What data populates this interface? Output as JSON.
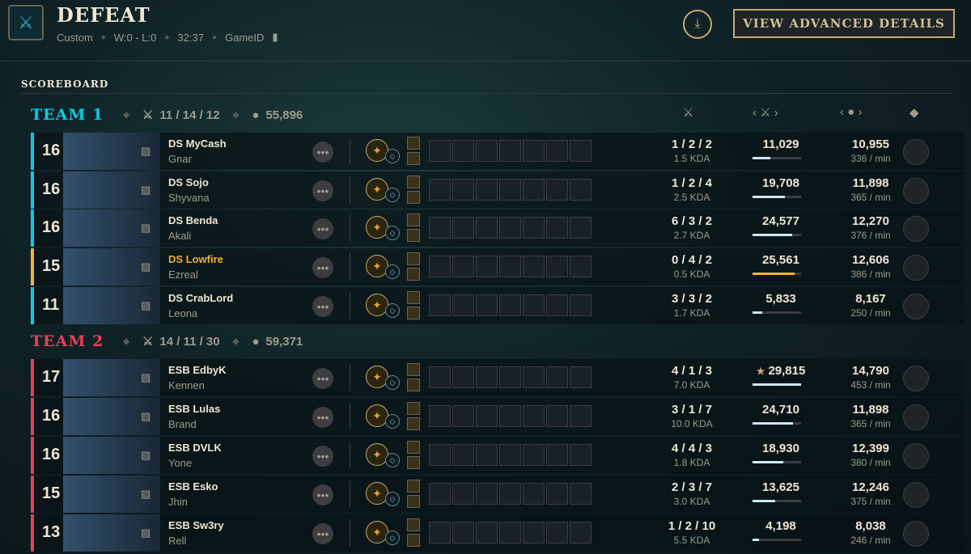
{
  "header": {
    "result": "DEFEAT",
    "mode": "Custom",
    "record": "W:0 - L:0",
    "duration": "32:37",
    "game_id_label": "GameID",
    "advanced_button": "VIEW ADVANCED DETAILS"
  },
  "scoreboard_label": "SCOREBOARD",
  "teams": [
    {
      "name": "TEAM 1",
      "color": "#0acbe6",
      "kda": "11 / 14 / 12",
      "gold": "55,896"
    },
    {
      "name": "TEAM 2",
      "color": "#e84057",
      "kda": "14 / 11 / 30",
      "gold": "59,371"
    }
  ],
  "players": [
    {
      "team": 0,
      "level": "16",
      "name": "DS MyCash",
      "champion": "Gnar",
      "kda": "1 / 2 / 2",
      "kda_ratio": "1.5 KDA",
      "damage": "11,029",
      "damage_fraction": 0.37,
      "gold": "10,955",
      "gold_per_min": "336 / min",
      "highlight": false
    },
    {
      "team": 0,
      "level": "16",
      "name": "DS Sojo",
      "champion": "Shyvana",
      "kda": "1 / 2 / 4",
      "kda_ratio": "2.5 KDA",
      "damage": "19,708",
      "damage_fraction": 0.66,
      "gold": "11,898",
      "gold_per_min": "365 / min",
      "highlight": false
    },
    {
      "team": 0,
      "level": "16",
      "name": "DS Benda",
      "champion": "Akali",
      "kda": "6 / 3 / 2",
      "kda_ratio": "2.7 KDA",
      "damage": "24,577",
      "damage_fraction": 0.82,
      "gold": "12,270",
      "gold_per_min": "376 / min",
      "highlight": false
    },
    {
      "team": 0,
      "level": "15",
      "name": "DS Lowfire",
      "champion": "Ezreal",
      "kda": "0 / 4 / 2",
      "kda_ratio": "0.5 KDA",
      "damage": "25,561",
      "damage_fraction": 0.86,
      "gold": "12,606",
      "gold_per_min": "386 / min",
      "highlight": true
    },
    {
      "team": 0,
      "level": "11",
      "name": "DS CrabLord",
      "champion": "Leona",
      "kda": "3 / 3 / 2",
      "kda_ratio": "1.7 KDA",
      "damage": "5,833",
      "damage_fraction": 0.2,
      "gold": "8,167",
      "gold_per_min": "250 / min",
      "highlight": false
    },
    {
      "team": 1,
      "level": "17",
      "name": "ESB EdbyK",
      "champion": "Kennen",
      "kda": "4 / 1 / 3",
      "kda_ratio": "7.0 KDA",
      "damage": "29,815",
      "damage_fraction": 1.0,
      "gold": "14,790",
      "gold_per_min": "453 / min",
      "highlight": false,
      "star": "★"
    },
    {
      "team": 1,
      "level": "16",
      "name": "ESB Lulas",
      "champion": "Brand",
      "kda": "3 / 1 / 7",
      "kda_ratio": "10.0 KDA",
      "damage": "24,710",
      "damage_fraction": 0.83,
      "gold": "11,898",
      "gold_per_min": "365 / min",
      "highlight": false
    },
    {
      "team": 1,
      "level": "16",
      "name": "ESB DVLK",
      "champion": "Yone",
      "kda": "4 / 4 / 3",
      "kda_ratio": "1.8 KDA",
      "damage": "18,930",
      "damage_fraction": 0.63,
      "gold": "12,399",
      "gold_per_min": "380 / min",
      "highlight": false
    },
    {
      "team": 1,
      "level": "15",
      "name": "ESB Esko",
      "champion": "Jhin",
      "kda": "2 / 3 / 7",
      "kda_ratio": "3.0 KDA",
      "damage": "13,625",
      "damage_fraction": 0.46,
      "gold": "12,246",
      "gold_per_min": "375 / min",
      "highlight": false
    },
    {
      "team": 1,
      "level": "13",
      "name": "ESB Sw3ry",
      "champion": "Rell",
      "kda": "1 / 2 / 10",
      "kda_ratio": "5.5 KDA",
      "damage": "4,198",
      "damage_fraction": 0.14,
      "gold": "8,038",
      "gold_per_min": "246 / min",
      "highlight": false
    }
  ],
  "colors": {
    "gold_accent": "#c8aa6e",
    "highlight_name": "#f0b232",
    "highlight_bar": "#f0b232"
  }
}
